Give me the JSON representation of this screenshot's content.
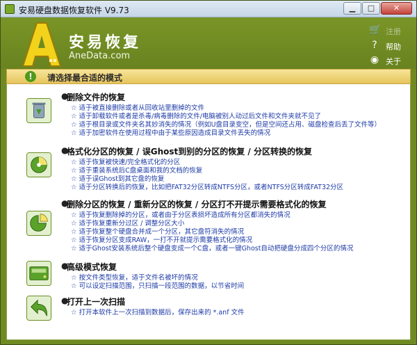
{
  "window": {
    "title": "安易硬盘数据恢复软件 V9.73",
    "controls": {
      "minimize": "▁",
      "maximize": "□",
      "close": "✕"
    }
  },
  "header": {
    "brand_cn": "安易恢复",
    "brand_en": "AneData.com",
    "links": [
      {
        "label": "注册",
        "icon": "cart-icon",
        "enabled": false
      },
      {
        "label": "帮助",
        "icon": "help-icon",
        "enabled": true
      },
      {
        "label": "关于",
        "icon": "about-icon",
        "enabled": true
      }
    ]
  },
  "section": {
    "title": "请选择最合适的模式",
    "icon": "!"
  },
  "options": [
    {
      "title": "删除文件的恢复",
      "lines": [
        "适于被直接删除或者从回收站里删掉的文件",
        "适于卸载软件或者是杀毒/病毒删除的文件/电脑被别人动过后文件和文件夹就不见了",
        "适于根目录或文件夹名其妙消失的情况（例如U盘目录变空，但是空间还占用、磁盘检查后丢了文件等）",
        "适于加密软件在使用过程中由于某些原因造成目录文件丢失的情况"
      ]
    },
    {
      "title": "格式化分区的恢复 / 误Ghost到别的分区的恢复 / 分区转换的恢复",
      "lines": [
        "适于恢复被快速/完全格式化的分区",
        "适于重装系统后C盘桌面和我的文档的恢复",
        "适于误Ghost到其它盘的恢复",
        "适于分区转换后的恢复，比如把FAT32分区转成NTFS分区，或者NTFS分区转成FAT32分区"
      ]
    },
    {
      "title": "删除分区的恢复 / 重新分区的恢复 / 分区打不开提示需要格式化的恢复",
      "lines": [
        "适于恢复删除掉的分区，或者由于分区表损坏造成所有分区都消失的情况",
        "适于恢复重新分过区 / 调整分区大小",
        "适于恢复整个硬盘合并成一个分区，其它盘符消失的情况",
        "适于恢复分区变成RAW，一打不开就提示需要格式化的情况",
        "适于Ghost安装系统后整个硬盘变成一个C盘，或者一键Ghost自动把硬盘分成四个分区的情况"
      ]
    },
    {
      "title": "高级模式恢复",
      "lines": [
        "按文件类型恢复，适于文件名被坏的情况",
        "可以设定扫描范围，只扫描一段范围的数据，以节省时间"
      ]
    },
    {
      "title": "打开上一次扫描",
      "lines": [
        "打开本软件上一次扫描到数据后，保存出来的 *.anf 文件"
      ]
    }
  ],
  "star_glyph": "☆",
  "bullet_glyph": "●",
  "colors": {
    "frame_green": "#6f8a22",
    "link_blue": "#1c3aa6",
    "bar_yellow": "#f0d56c"
  }
}
